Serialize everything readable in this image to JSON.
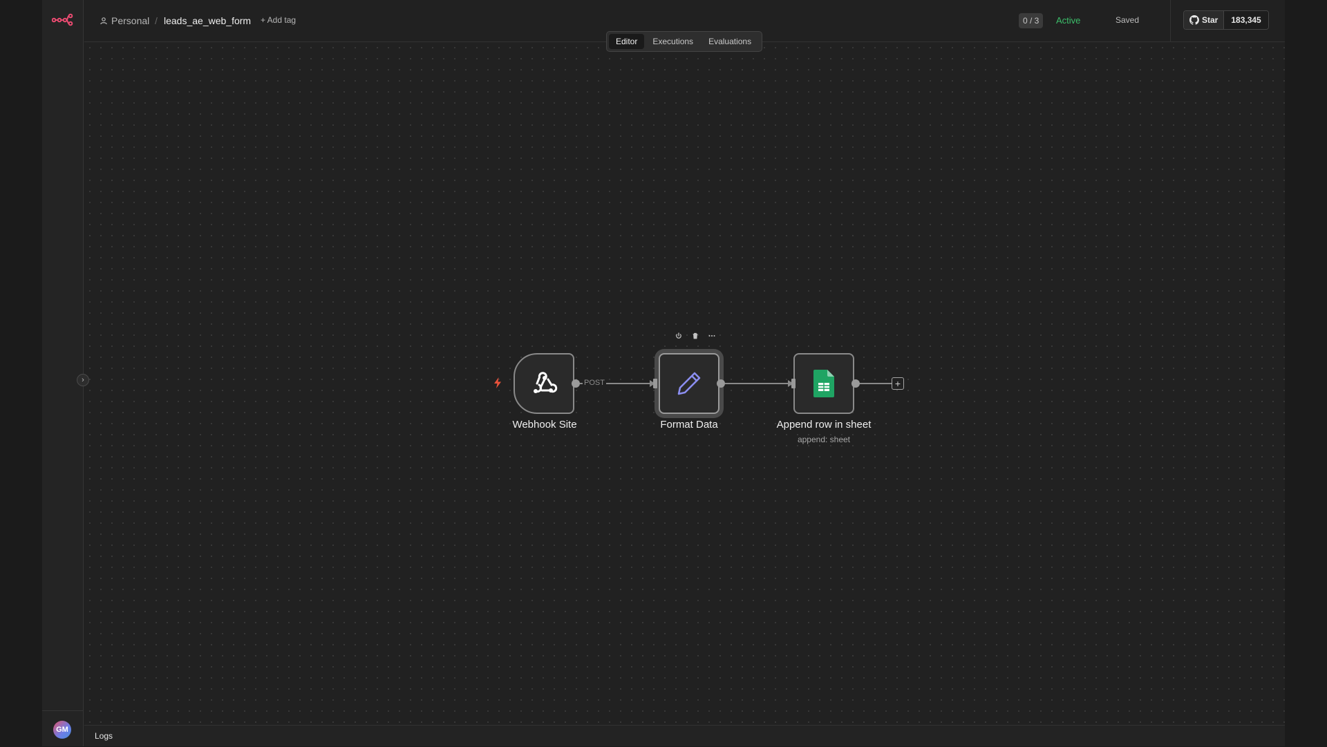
{
  "breadcrumb": {
    "project": "Personal",
    "separator": "/",
    "workflow_name": "leads_ae_web_form"
  },
  "header": {
    "add_tag": "+ Add tag",
    "counter": "0 / 3",
    "status": "Active",
    "save_state": "Saved"
  },
  "github": {
    "star_label": "Star",
    "star_count": "183,345"
  },
  "tabs": [
    {
      "label": "Editor",
      "active": true
    },
    {
      "label": "Executions",
      "active": false
    },
    {
      "label": "Evaluations",
      "active": false
    }
  ],
  "nodes": [
    {
      "label": "Webhook Site",
      "icon": "webhook-icon"
    },
    {
      "label": "Format Data",
      "icon": "pencil-icon"
    },
    {
      "label": "Append row in sheet",
      "subtitle": "append: sheet",
      "icon": "google-sheets-icon"
    }
  ],
  "edge_label": "POST",
  "user": {
    "initials": "GM"
  },
  "logs": {
    "label": "Logs"
  },
  "colors": {
    "accent": "#ea4b71",
    "active": "#3cbf6a",
    "sheets_green": "#1fa463",
    "edit_purple": "#8b8ef0"
  }
}
